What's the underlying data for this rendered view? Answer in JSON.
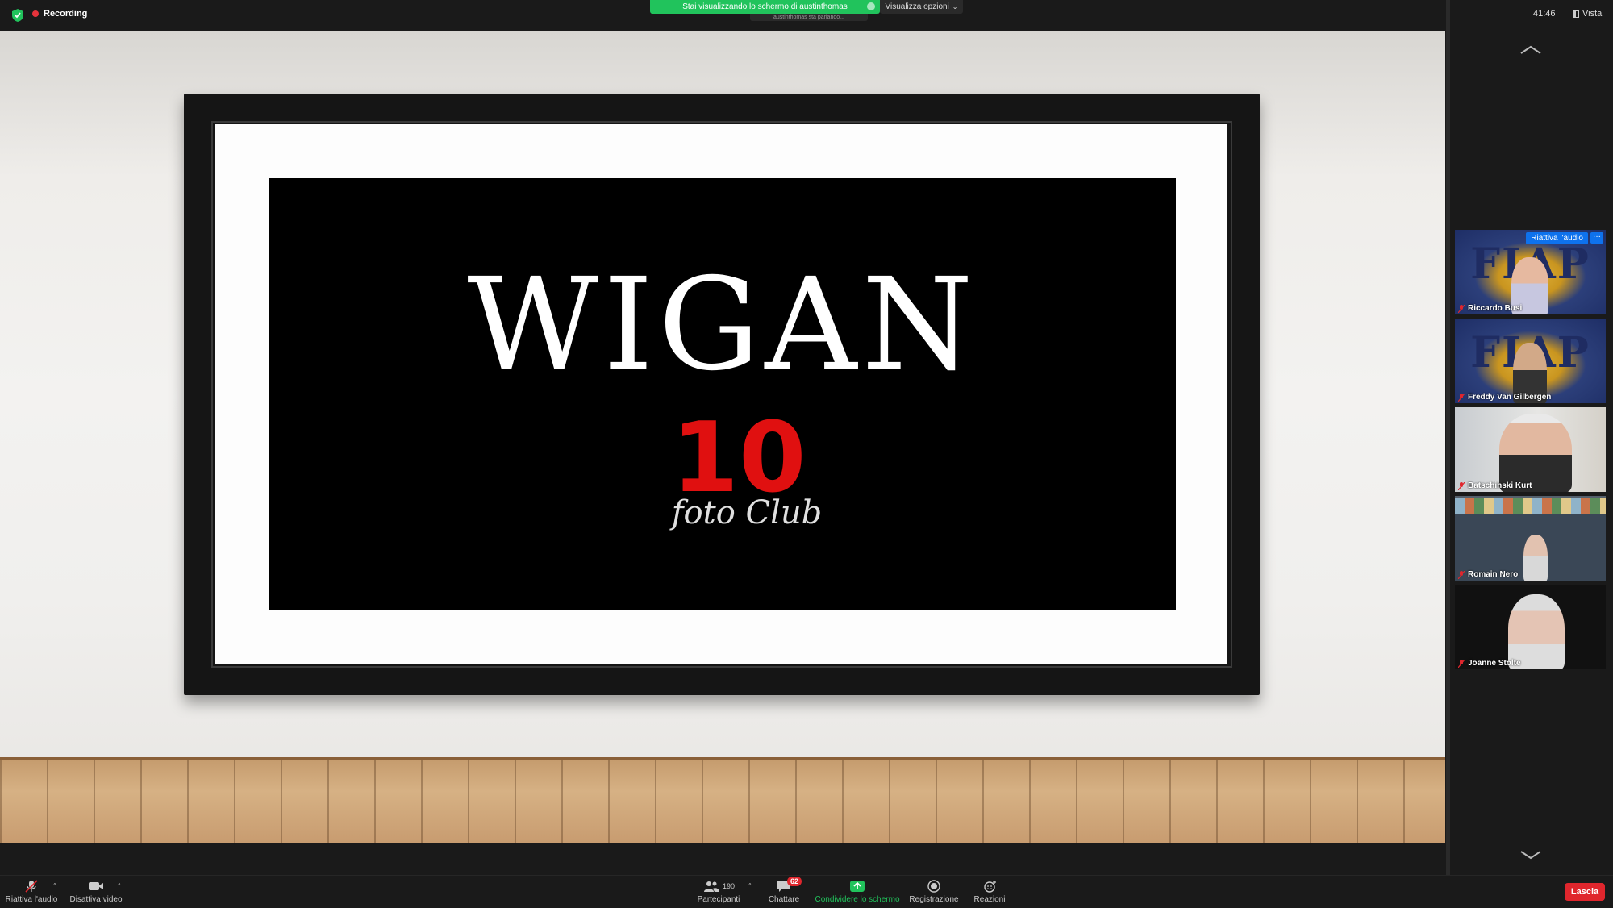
{
  "topbar": {
    "recording_label": "Recording",
    "share_banner": "Stai visualizzando lo schermo di austinthomas",
    "view_options": "Visualizza opzioni",
    "speaking_notice": "austinthomas sta parlando..."
  },
  "slide": {
    "title": "WIGAN",
    "number": "10",
    "subtitle": "foto Club"
  },
  "panel": {
    "clock": "41:46",
    "view_label": "Vista",
    "unmute_badge": "Riattiva l'audio",
    "participants": [
      {
        "name": "Riccardo Busi"
      },
      {
        "name": "Freddy Van Gilbergen"
      },
      {
        "name": "Batschinski Kurt"
      },
      {
        "name": "Romain Nero"
      },
      {
        "name": "Joanne Stolte"
      }
    ]
  },
  "toolbar": {
    "unmute": "Riattiva l'audio",
    "stop_video": "Disattiva video",
    "participants_count": "190",
    "participants": "Partecipanti",
    "chat": "Chattare",
    "chat_badge": "62",
    "share": "Condividere lo schermo",
    "record": "Registrazione",
    "reactions": "Reazioni",
    "leave": "Lascia"
  },
  "colors": {
    "share_green": "#21c35c",
    "leave_red": "#e0262d",
    "accent_blue": "#0e72ed",
    "recording_red": "#e5333b"
  }
}
